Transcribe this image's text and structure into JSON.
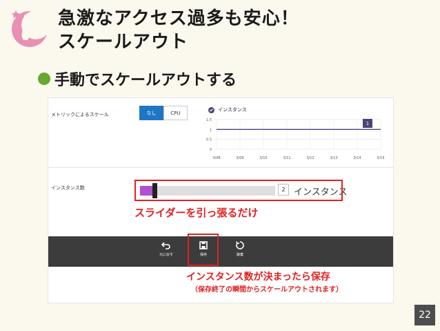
{
  "slide": {
    "title_line1": "急激なアクセス過多も安心！",
    "title_line2": "スケールアウト",
    "bullet": "手動でスケールアウトする",
    "page_number": "22"
  },
  "portal": {
    "metric_scale_label": "メトリックによるスケール",
    "toggle": {
      "none": "なし",
      "cpu": "CPU",
      "selected": "なし"
    },
    "legend": "インスタンス",
    "chart_badge": "1",
    "instance_count_label": "インスタンス数",
    "instance_count_value": "2",
    "instance_unit": "インスタンス",
    "slider_fraction": 0.09,
    "toolbar": {
      "undo": "元に戻す",
      "save": "保存",
      "discard": "破棄"
    }
  },
  "annotations": {
    "slider_note": "スライダーを引っ張るだけ",
    "save_note_line1": "インスタンス数が決まったら保存",
    "save_note_line2": "（保存終了の瞬間からスケールアウトされます）"
  },
  "colors": {
    "accent_red": "#e02020",
    "bullet_green": "#66a832",
    "toggle_blue": "#1f76c2",
    "slider_purple": "#b04fcf",
    "series_purple": "#4e4376"
  },
  "chart_data": {
    "type": "line",
    "x": [
      "3/08",
      "3/09",
      "3/10",
      "3/11",
      "3/12",
      "3/13",
      "3/14",
      "3/15"
    ],
    "y_ticks": [
      "1.5",
      "1",
      "0.5",
      "0"
    ],
    "ylim": [
      0,
      1.5
    ],
    "series": [
      {
        "name": "インスタンス",
        "values": [
          1,
          1,
          1,
          1,
          1,
          1,
          1,
          1
        ]
      }
    ],
    "grid": true
  }
}
